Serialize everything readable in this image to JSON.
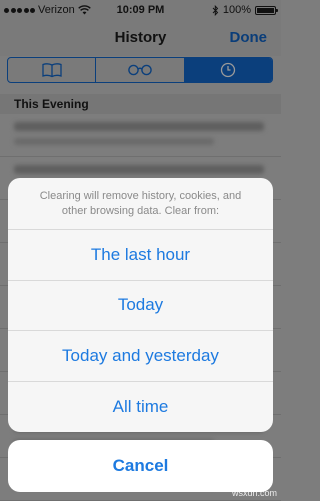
{
  "status_bar": {
    "carrier": "Verizon",
    "time": "10:09 PM",
    "battery": "100%",
    "icons": [
      "signal-icon",
      "wifi-icon",
      "bluetooth-icon",
      "battery-icon"
    ]
  },
  "nav": {
    "title": "History",
    "done_label": "Done"
  },
  "tabs": [
    {
      "icon": "book-icon",
      "active": false
    },
    {
      "icon": "glasses-icon",
      "active": false
    },
    {
      "icon": "clock-icon",
      "active": true
    }
  ],
  "section_header": "This Evening",
  "action_sheet": {
    "message": "Clearing will remove history, cookies, and other browsing data. Clear from:",
    "options": [
      "The last hour",
      "Today",
      "Today and yesterday",
      "All time"
    ],
    "cancel_label": "Cancel"
  },
  "watermark": "wsxdn.com",
  "colors": {
    "accent": "#1d7ae0",
    "dim_overlay": "#7d7d7d",
    "nav_accent_dimmed": "#0b3f7c"
  }
}
